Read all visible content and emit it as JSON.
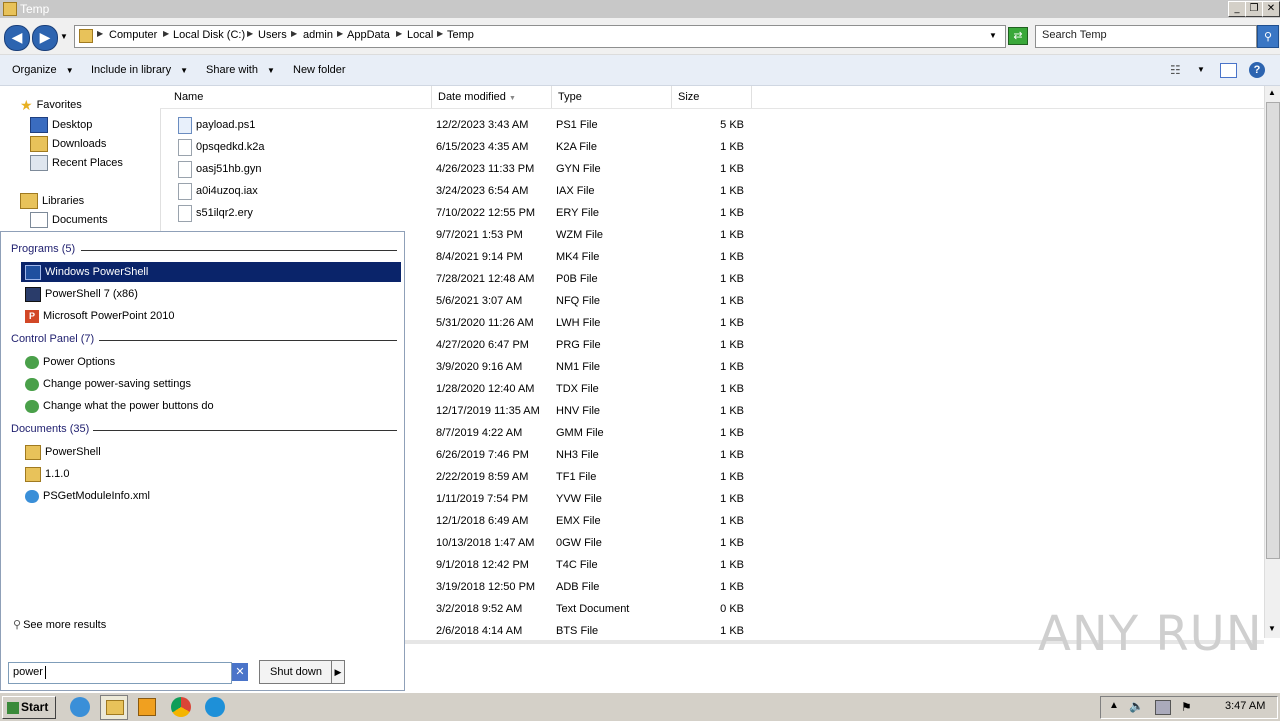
{
  "window": {
    "title": "Temp"
  },
  "address": {
    "crumbs": [
      "Computer",
      "Local Disk (C:)",
      "Users",
      "admin",
      "AppData",
      "Local",
      "Temp"
    ],
    "search_placeholder": "Search Temp"
  },
  "toolbar": {
    "organize": "Organize",
    "include_in_library": "Include in library",
    "share_with": "Share with",
    "new_folder": "New folder"
  },
  "nav": {
    "favorites": "Favorites",
    "desktop": "Desktop",
    "downloads": "Downloads",
    "recent_places": "Recent Places",
    "libraries": "Libraries",
    "documents": "Documents"
  },
  "columns": {
    "name": "Name",
    "date_modified": "Date modified",
    "type": "Type",
    "size": "Size"
  },
  "files": [
    {
      "name": "payload.ps1",
      "date": "12/2/2023 3:43 AM",
      "type": "PS1 File",
      "size": "5 KB"
    },
    {
      "name": "0psqedkd.k2a",
      "date": "6/15/2023 4:35 AM",
      "type": "K2A File",
      "size": "1 KB"
    },
    {
      "name": "oasj51hb.gyn",
      "date": "4/26/2023 11:33 PM",
      "type": "GYN File",
      "size": "1 KB"
    },
    {
      "name": "a0i4uzoq.iax",
      "date": "3/24/2023 6:54 AM",
      "type": "IAX File",
      "size": "1 KB"
    },
    {
      "name": "s51ilqr2.ery",
      "date": "7/10/2022 12:55 PM",
      "type": "ERY File",
      "size": "1 KB"
    },
    {
      "name": "",
      "date": "9/7/2021 1:53 PM",
      "type": "WZM File",
      "size": "1 KB"
    },
    {
      "name": "",
      "date": "8/4/2021 9:14 PM",
      "type": "MK4 File",
      "size": "1 KB"
    },
    {
      "name": "",
      "date": "7/28/2021 12:48 AM",
      "type": "P0B File",
      "size": "1 KB"
    },
    {
      "name": "",
      "date": "5/6/2021 3:07 AM",
      "type": "NFQ File",
      "size": "1 KB"
    },
    {
      "name": "",
      "date": "5/31/2020 11:26 AM",
      "type": "LWH File",
      "size": "1 KB"
    },
    {
      "name": "",
      "date": "4/27/2020 6:47 PM",
      "type": "PRG File",
      "size": "1 KB"
    },
    {
      "name": "",
      "date": "3/9/2020 9:16 AM",
      "type": "NM1 File",
      "size": "1 KB"
    },
    {
      "name": "",
      "date": "1/28/2020 12:40 AM",
      "type": "TDX File",
      "size": "1 KB"
    },
    {
      "name": "",
      "date": "12/17/2019 11:35 AM",
      "type": "HNV File",
      "size": "1 KB"
    },
    {
      "name": "",
      "date": "8/7/2019 4:22 AM",
      "type": "GMM File",
      "size": "1 KB"
    },
    {
      "name": "",
      "date": "6/26/2019 7:46 PM",
      "type": "NH3 File",
      "size": "1 KB"
    },
    {
      "name": "",
      "date": "2/22/2019 8:59 AM",
      "type": "TF1 File",
      "size": "1 KB"
    },
    {
      "name": "",
      "date": "1/11/2019 7:54 PM",
      "type": "YVW File",
      "size": "1 KB"
    },
    {
      "name": "",
      "date": "12/1/2018 6:49 AM",
      "type": "EMX File",
      "size": "1 KB"
    },
    {
      "name": "",
      "date": "10/13/2018 1:47 AM",
      "type": "0GW File",
      "size": "1 KB"
    },
    {
      "name": "",
      "date": "9/1/2018 12:42 PM",
      "type": "T4C File",
      "size": "1 KB"
    },
    {
      "name": "",
      "date": "3/19/2018 12:50 PM",
      "type": "ADB File",
      "size": "1 KB"
    },
    {
      "name": "",
      "date": "3/2/2018 9:52 AM",
      "type": "Text Document",
      "size": "0 KB"
    },
    {
      "name": "",
      "date": "2/6/2018 4:14 AM",
      "type": "BTS File",
      "size": "1 KB"
    }
  ],
  "start_menu": {
    "programs_header": "Programs (5)",
    "programs": [
      "Windows PowerShell",
      "PowerShell 7 (x86)",
      "Microsoft PowerPoint 2010"
    ],
    "control_header": "Control Panel (7)",
    "control": [
      "Power Options",
      "Change power-saving settings",
      "Change what the power buttons do"
    ],
    "documents_header": "Documents (35)",
    "documents": [
      "PowerShell",
      "1.1.0",
      "PSGetModuleInfo.xml"
    ],
    "see_more": "See more results",
    "search_value": "power",
    "shutdown": "Shut down"
  },
  "taskbar": {
    "start": "Start",
    "clock": "3:47 AM"
  },
  "watermark": "ANY RUN"
}
